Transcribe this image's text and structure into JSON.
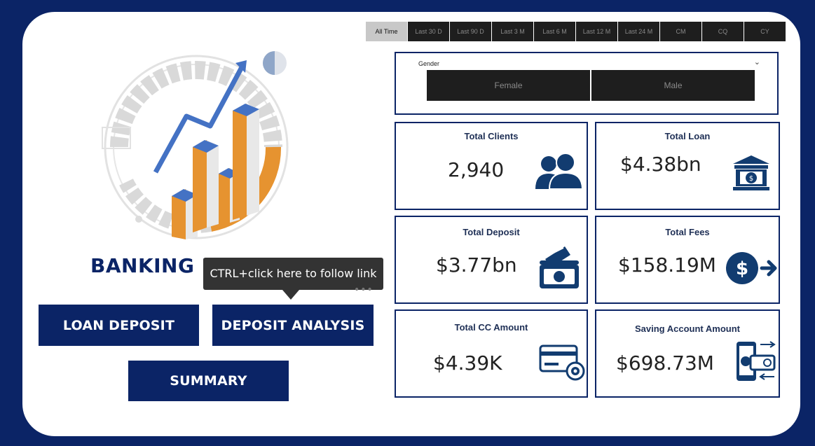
{
  "time_filters": [
    "All Time",
    "Last 30 D",
    "Last 90 D",
    "Last 3 M",
    "Last 6 M",
    "Last 12 M",
    "Last 24 M",
    "CM",
    "CQ",
    "CY"
  ],
  "gender": {
    "label": "Gender",
    "options": [
      "Female",
      "Male"
    ]
  },
  "kpis": {
    "clients": {
      "title": "Total Clients",
      "value": "2,940"
    },
    "loan": {
      "title": "Total Loan",
      "value": "$4.38bn"
    },
    "deposit": {
      "title": "Total Deposit",
      "value": "$3.77bn"
    },
    "fees": {
      "title": "Total Fees",
      "value": "$158.19M"
    },
    "cc": {
      "title": "Total CC Amount",
      "value": "$4.39K"
    },
    "saving": {
      "title": "Saving Account Amount",
      "value": "$698.73M"
    }
  },
  "brand_title": "BANKING D",
  "tooltip": "CTRL+click here to follow link",
  "nav": {
    "loan_deposit": "LOAN DEPOSIT",
    "deposit_analysis": "DEPOSIT ANALYSIS",
    "summary": "SUMMARY"
  },
  "colors": {
    "navy": "#0b2466",
    "icon_blue": "#123c70",
    "orange": "#e69330",
    "accent_blue": "#4472c4"
  }
}
